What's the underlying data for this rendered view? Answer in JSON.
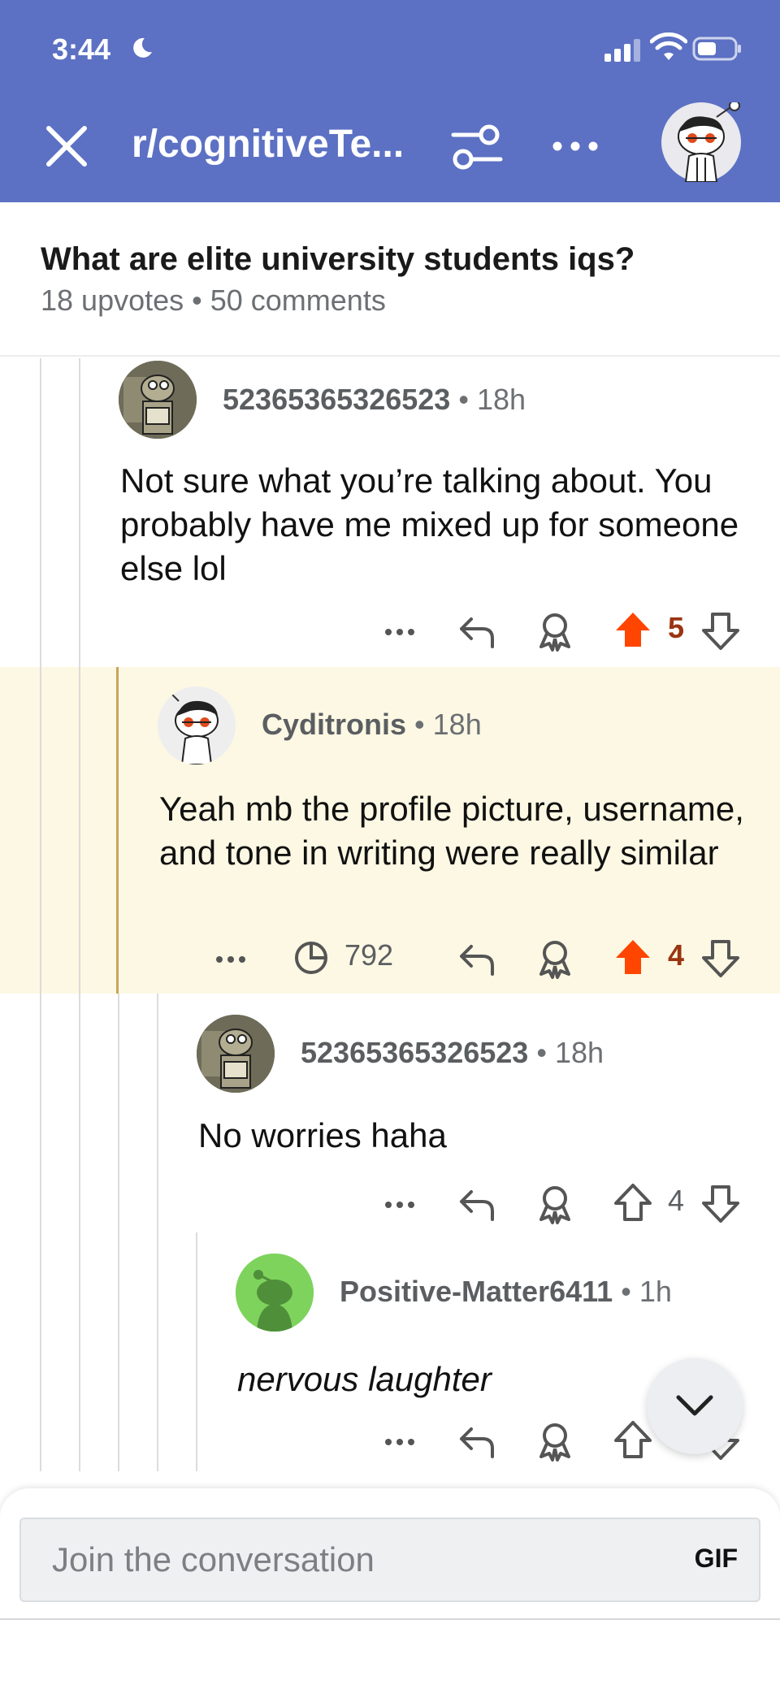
{
  "status_bar": {
    "time": "3:44"
  },
  "header": {
    "subreddit": "r/cognitiveTe..."
  },
  "post": {
    "title": "What are elite university students iqs?",
    "meta": "18 upvotes • 50 comments"
  },
  "comments": [
    {
      "username": "52365365326523",
      "separator": "•",
      "time": "18h",
      "body": "Not sure what  you’re talking about. You probably have me mixed up for someone else lol",
      "score": "5",
      "upvoted": true
    },
    {
      "username": "Cyditronis",
      "separator": "•",
      "time": "18h",
      "body": "Yeah mb the profile picture, username, and tone in writing were really similar",
      "views": "792",
      "score": "4",
      "upvoted": true
    },
    {
      "username": "52365365326523",
      "separator": "•",
      "time": "18h",
      "body": "No worries haha",
      "score": "4",
      "upvoted": false
    },
    {
      "username": "Positive-Matter6411",
      "separator": "•",
      "time": "1h",
      "body": "nervous laughter",
      "upvoted": false
    }
  ],
  "composer": {
    "placeholder": "Join the conversation",
    "gif_label": "GIF"
  },
  "colors": {
    "header_bg": "#5c71c4",
    "upvote_orange": "#ff4500",
    "highlight_bg": "#fcf8e3",
    "gold_rail": "#c7a559"
  },
  "icons": [
    "close-icon",
    "filter-icon",
    "more-icon",
    "reply-icon",
    "award-icon",
    "upvote-icon",
    "downvote-icon",
    "views-icon",
    "chevron-down-icon"
  ]
}
